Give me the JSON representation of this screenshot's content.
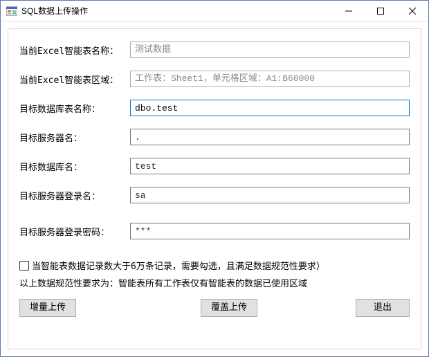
{
  "window": {
    "title": "SQL数据上传操作"
  },
  "labels": {
    "excel_name": "当前Excel智能表名称：",
    "excel_range": "当前Excel智能表区域：",
    "target_table": "目标数据库表名称：",
    "target_server": "目标服务器名：",
    "target_db": "目标数据库名：",
    "target_login": "目标服务器登录名：",
    "target_password": "目标服务器登录密码："
  },
  "values": {
    "excel_name": "测试数据",
    "excel_range": "工作表：Sheet1，单元格区域：A1:B60000",
    "target_table": "dbo.test",
    "target_server": ".",
    "target_db": "test",
    "target_login": "sa",
    "target_password": "***"
  },
  "checkbox": {
    "label": "当智能表数据记录数大于6万条记录，需要勾选，且满足数据规范性要求）"
  },
  "note": "以上数据规范性要求为：智能表所有工作表仅有智能表的数据已使用区域",
  "buttons": {
    "append": "增量上传",
    "overwrite": "覆盖上传",
    "exit": "退出"
  }
}
